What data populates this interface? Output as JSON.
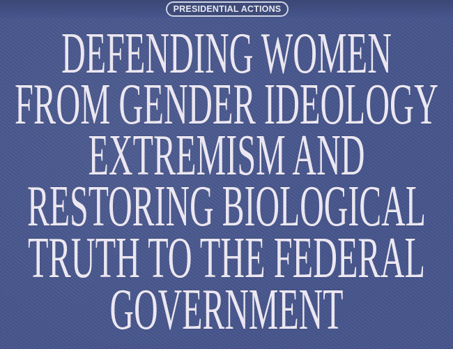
{
  "badge": "PRESIDENTIAL ACTIONS",
  "title_lines": [
    "DEFENDING WOMEN",
    "FROM GENDER IDEOLOGY",
    "EXTREMISM AND",
    "RESTORING BIOLOGICAL",
    "TRUTH TO THE FEDERAL",
    "GOVERNMENT"
  ],
  "colors": {
    "background": "#46558c",
    "text": "#ebe7f2"
  }
}
